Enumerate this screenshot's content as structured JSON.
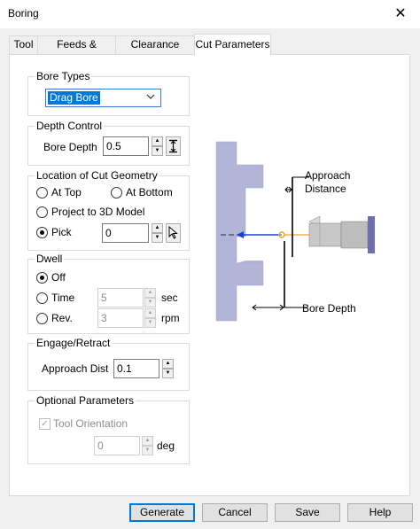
{
  "window": {
    "title": "Boring",
    "close_glyph": "✕"
  },
  "tabs": [
    {
      "label": "Tool"
    },
    {
      "label": "Feeds & Speeds"
    },
    {
      "label": "Clearance Plane"
    },
    {
      "label": "Cut Parameters"
    }
  ],
  "bore_types": {
    "label": "Bore Types",
    "selected": "Drag Bore"
  },
  "depth_control": {
    "label": "Depth Control",
    "bore_depth_label": "Bore Depth",
    "bore_depth_value": "0.5"
  },
  "location": {
    "label": "Location of Cut Geometry",
    "at_top": "At Top",
    "at_bottom": "At Bottom",
    "project": "Project to 3D Model",
    "pick": "Pick",
    "pick_value": "0",
    "selected": "pick"
  },
  "dwell": {
    "label": "Dwell",
    "off": "Off",
    "time": "Time",
    "time_value": "5",
    "time_unit": "sec",
    "rev": "Rev.",
    "rev_value": "3",
    "rev_unit": "rpm",
    "selected": "off"
  },
  "engage": {
    "label": "Engage/Retract",
    "approach_label": "Approach Dist",
    "approach_value": "0.1"
  },
  "optional": {
    "label": "Optional Parameters",
    "tool_orientation": "Tool Orientation",
    "tool_orientation_checked": true,
    "angle_value": "0",
    "angle_unit": "deg"
  },
  "diagram": {
    "approach_line1": "Approach",
    "approach_line2": "Distance",
    "bore_depth": "Bore Depth",
    "part_color": "#aeb1d6",
    "arrow_color": "#1b3fd6",
    "point_color": "#f0a030",
    "tool_color": "#b0b0b0",
    "holder_color": "#6b6fb0"
  },
  "buttons": {
    "generate": "Generate",
    "cancel": "Cancel",
    "save": "Save",
    "help": "Help"
  }
}
